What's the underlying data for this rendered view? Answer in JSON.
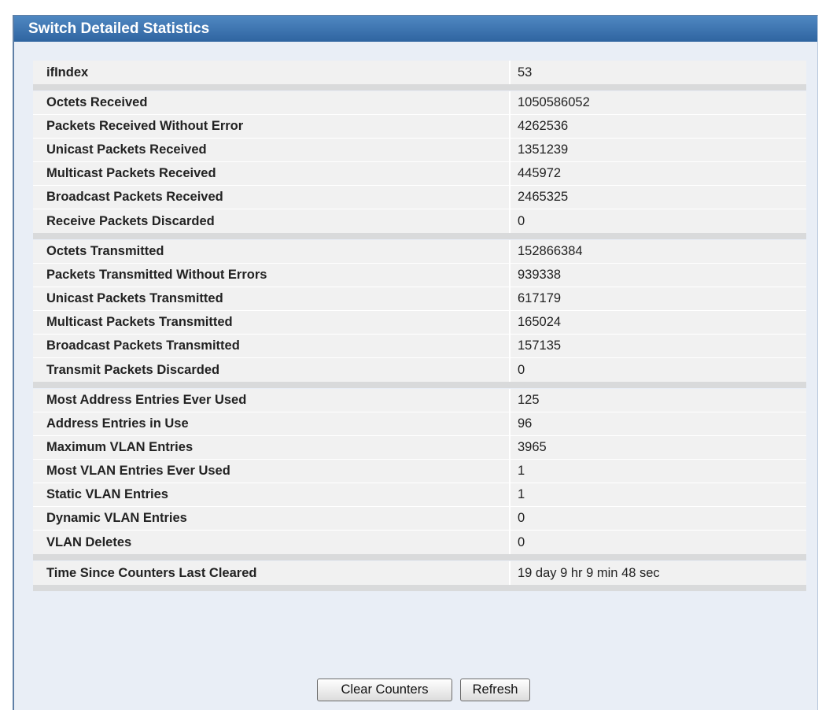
{
  "panel": {
    "title": "Switch Detailed Statistics"
  },
  "groups": [
    [
      {
        "label": "ifIndex",
        "value": "53"
      }
    ],
    [
      {
        "label": "Octets Received",
        "value": "1050586052"
      },
      {
        "label": "Packets Received Without Error",
        "value": "4262536"
      },
      {
        "label": "Unicast Packets Received",
        "value": "1351239"
      },
      {
        "label": "Multicast Packets Received",
        "value": "445972"
      },
      {
        "label": "Broadcast Packets Received",
        "value": "2465325"
      },
      {
        "label": "Receive Packets Discarded",
        "value": "0"
      }
    ],
    [
      {
        "label": "Octets Transmitted",
        "value": "152866384"
      },
      {
        "label": "Packets Transmitted Without Errors",
        "value": "939338"
      },
      {
        "label": "Unicast Packets Transmitted",
        "value": "617179"
      },
      {
        "label": "Multicast Packets Transmitted",
        "value": "165024"
      },
      {
        "label": "Broadcast Packets Transmitted",
        "value": "157135"
      },
      {
        "label": "Transmit Packets Discarded",
        "value": "0"
      }
    ],
    [
      {
        "label": "Most Address Entries Ever Used",
        "value": "125"
      },
      {
        "label": "Address Entries in Use",
        "value": "96"
      },
      {
        "label": "Maximum VLAN Entries",
        "value": "3965"
      },
      {
        "label": "Most VLAN Entries Ever Used",
        "value": "1"
      },
      {
        "label": "Static VLAN Entries",
        "value": "1"
      },
      {
        "label": "Dynamic VLAN Entries",
        "value": "0"
      },
      {
        "label": "VLAN Deletes",
        "value": "0"
      }
    ],
    [
      {
        "label": "Time Since Counters Last Cleared",
        "value": "19 day 9 hr 9 min 48 sec"
      }
    ]
  ],
  "buttons": {
    "clear_label": "Clear Counters",
    "refresh_label": "Refresh"
  }
}
